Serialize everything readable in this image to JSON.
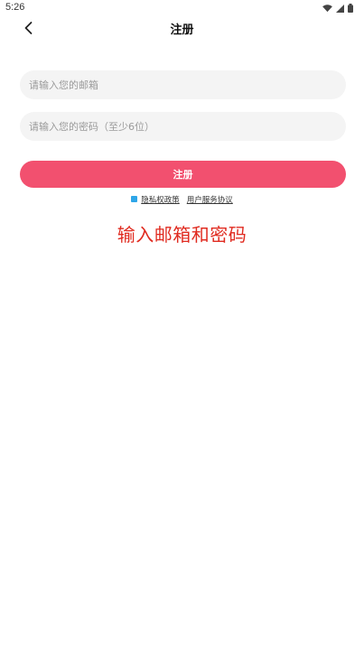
{
  "status_bar": {
    "time": "5:26",
    "icons": [
      "wifi-icon",
      "signal-icon",
      "battery-icon"
    ]
  },
  "header": {
    "title": "注册",
    "back_icon": "chevron-left-icon"
  },
  "form": {
    "email_placeholder": "请输入您的邮箱",
    "email_value": "",
    "password_placeholder": "请输入您的密码（至少6位）",
    "password_value": "",
    "submit_label": "注册"
  },
  "agreement": {
    "checked": true,
    "privacy_label": "隐私权政策",
    "terms_label": "用户服务协议"
  },
  "hint": "输入邮箱和密码",
  "colors": {
    "primary": "#f2506f",
    "hint": "#e02b20",
    "checkbox": "#2ea6e8",
    "field_bg": "#f4f4f4"
  }
}
